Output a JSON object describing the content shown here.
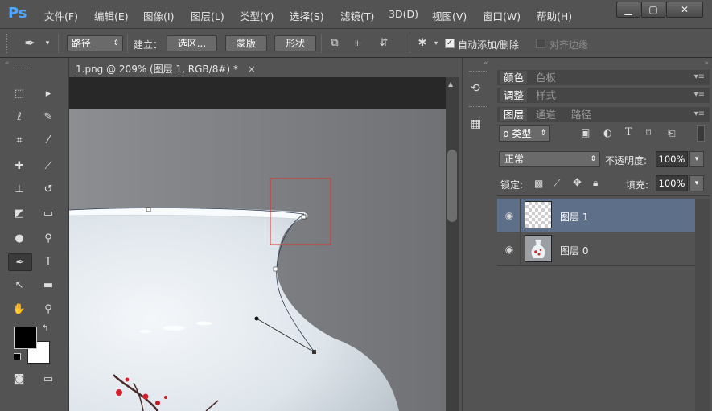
{
  "app": {
    "logo": "Ps"
  },
  "menu": [
    "文件(F)",
    "编辑(E)",
    "图像(I)",
    "图层(L)",
    "类型(Y)",
    "选择(S)",
    "滤镜(T)",
    "3D(D)",
    "视图(V)",
    "窗口(W)",
    "帮助(H)"
  ],
  "window_controls": {
    "minimize": "▁",
    "maximize": "▢",
    "close": "✕"
  },
  "options": {
    "mode": "路径",
    "make_label": "建立：",
    "selection_btn": "选区...",
    "mask_btn": "蒙版",
    "shape_btn": "形状",
    "auto_add_delete": "自动添加/删除",
    "align_edges": "对齐边缘"
  },
  "document": {
    "tab_title": "1.png @ 209% (图层 1, RGB/8#) *",
    "close": "×"
  },
  "panels": {
    "row1": [
      "颜色",
      "色板"
    ],
    "row2": [
      "调整",
      "样式"
    ],
    "row3": [
      "图层",
      "通道",
      "路径"
    ],
    "filter_label": "ρ 类型",
    "blend_mode": "正常",
    "opacity_label": "不透明度:",
    "opacity_value": "100%",
    "lock_label": "锁定:",
    "fill_label": "填充:",
    "fill_value": "100%",
    "layers": [
      {
        "name": "图层 1",
        "selected": true
      },
      {
        "name": "图层 0",
        "selected": false
      }
    ]
  },
  "colors": {
    "accent": "#4fa6ff",
    "selected_layer": "#5e6f8a",
    "path_box": "#e03030"
  }
}
